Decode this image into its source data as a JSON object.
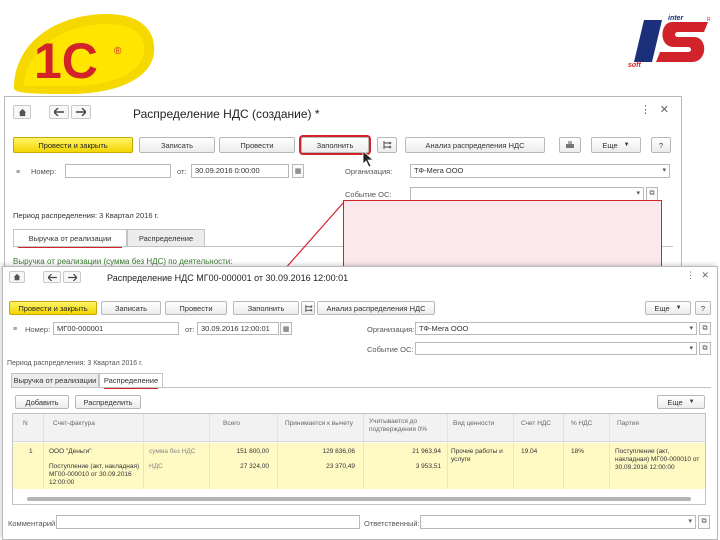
{
  "logos": {
    "onec": "1С",
    "onec_reg": "®",
    "inter_soft_top": "inter",
    "inter_soft_bottom": "soft",
    "inter_soft_reg": "R"
  },
  "colors": {
    "accent_red": "#d2232a",
    "primary_button": "#f3d600",
    "brand_blue": "#1b2f7a",
    "highlight_row": "#fff9c4"
  },
  "back_window": {
    "title": "Распределение НДС (создание) *",
    "toolbar": {
      "post_close": "Провести и закрыть",
      "save": "Записать",
      "post": "Провести",
      "fill": "Заполнить",
      "analysis": "Анализ распределения НДС",
      "more": "Еще",
      "help": "?"
    },
    "fields": {
      "number_label": "Номер:",
      "number_value": "",
      "date_label": "от:",
      "date_value": "30.09.2016 0:00:00",
      "org_label": "Организация:",
      "org_value": "ТФ-Мега ООО",
      "event_label": "Событие ОС:",
      "event_value": ""
    },
    "period_text": "Период распределения: 3 Квартал 2016 г.",
    "tabs": [
      "Выручка от реализации",
      "Распределение"
    ],
    "section_title": "Выручка от реализации (сумма без НДС) по деятельности:"
  },
  "front_window": {
    "title": "Распределение НДС МГ00-000001 от 30.09.2016 12:00:01",
    "toolbar": {
      "post_close": "Провести и закрыть",
      "save": "Записать",
      "post": "Провести",
      "fill": "Заполнить",
      "analysis": "Анализ распределения НДС",
      "more": "Еще",
      "help": "?"
    },
    "fields": {
      "number_label": "Номер:",
      "number_value": "МГ00-000001",
      "date_label": "от:",
      "date_value": "30.09.2016 12:00:01",
      "org_label": "Организация:",
      "org_value": "ТФ-Мега ООО",
      "event_label": "Событие ОС:",
      "event_value": ""
    },
    "period_text": "Период распределения: 3 Квартал 2016 г.",
    "tabs": [
      "Выручка от реализации",
      "Распределение"
    ],
    "table_toolbar": {
      "add": "Добавить",
      "distribute": "Распределить",
      "more": "Еще"
    },
    "table": {
      "columns": [
        "N",
        "Счет-фактура",
        "",
        "Всего",
        "Принимается к вычету",
        "Учитывается до подтверждения 0%",
        "Вид ценности",
        "Счет НДС",
        "% НДС",
        "Партия"
      ],
      "row": {
        "n": "1",
        "invoice_line1": "ООО \"Деньги\"",
        "invoice_line2": "Поступление (акт, накладная) МГ00-000010 от 30.09.2016 12:00:00",
        "kind_line1": "сумма без НДС",
        "kind_line2": "НДС",
        "total_line1": "151 800,00",
        "total_line2": "27 324,00",
        "deduct_line1": "129 836,06",
        "deduct_line2": "23 370,49",
        "zero_line1": "21 963,94",
        "zero_line2": "3 953,51",
        "value_type": "Прочие работы и услуги",
        "vat_account": "19.04",
        "vat_rate": "18%",
        "batch": "Поступление (акт, накладная) МГ00-000010 от 30.09.2016 12:00:00"
      }
    },
    "footer": {
      "comment_label": "Комментарий:",
      "comment_value": "",
      "responsible_label": "Ответственный:",
      "responsible_value": ""
    }
  }
}
